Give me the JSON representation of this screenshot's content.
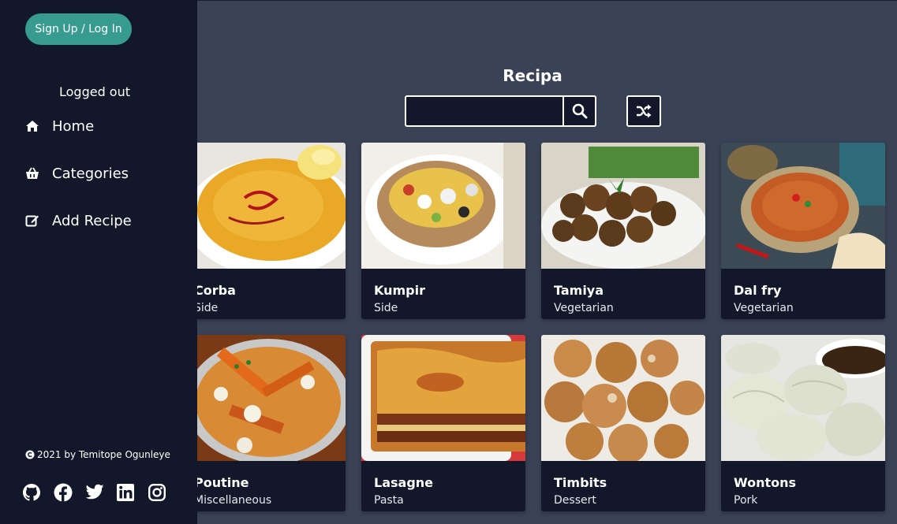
{
  "sidebar": {
    "signup_label": "Sign Up / Log In",
    "status": "Logged out",
    "nav": [
      {
        "label": "Home",
        "icon": "home-icon"
      },
      {
        "label": "Categories",
        "icon": "basket-icon"
      },
      {
        "label": "Add Recipe",
        "icon": "edit-icon"
      }
    ],
    "credit": "2021 by Temitope Ogunleye",
    "socials": [
      "github-icon",
      "facebook-icon",
      "twitter-icon",
      "linkedin-icon",
      "instagram-icon"
    ]
  },
  "header": {
    "title": "Recipa",
    "search_placeholder": ""
  },
  "recipes": [
    {
      "name": "Corba",
      "category": "Side"
    },
    {
      "name": "Kumpir",
      "category": "Side"
    },
    {
      "name": "Tamiya",
      "category": "Vegetarian"
    },
    {
      "name": "Dal fry",
      "category": "Vegetarian"
    },
    {
      "name": "Poutine",
      "category": "Miscellaneous"
    },
    {
      "name": "Lasagne",
      "category": "Pasta"
    },
    {
      "name": "Timbits",
      "category": "Dessert"
    },
    {
      "name": "Wontons",
      "category": "Pork"
    }
  ],
  "colors": {
    "background": "#3a4256",
    "sidebar": "#121829",
    "card": "#121829",
    "accent": "#389b8f"
  }
}
